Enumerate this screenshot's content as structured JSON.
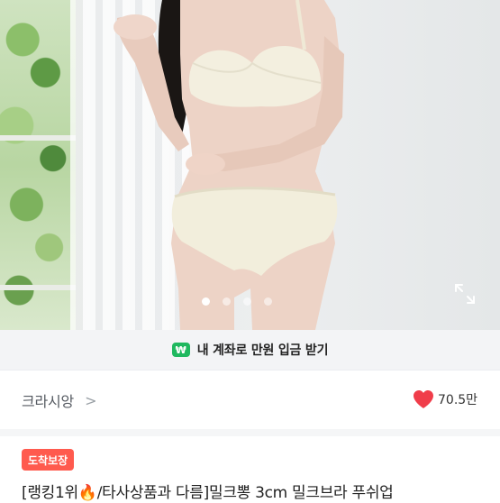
{
  "carousel": {
    "page_count": 4,
    "active_index": 0
  },
  "banner": {
    "badge": "₩",
    "text": "내 계좌로 만원 입금 받기"
  },
  "shop": {
    "name": "크라시앙",
    "chevron": ">",
    "likes": "70.5만"
  },
  "product": {
    "badge": "도착보장",
    "title": "[랭킹1위🔥/타사상품과 다름]밀크뽕 3cm 밀크브라 푸쉬업"
  },
  "colors": {
    "badge_red": "#ff5a4e",
    "heart_red": "#f03d4a",
    "won_green": "#1fb85f"
  }
}
